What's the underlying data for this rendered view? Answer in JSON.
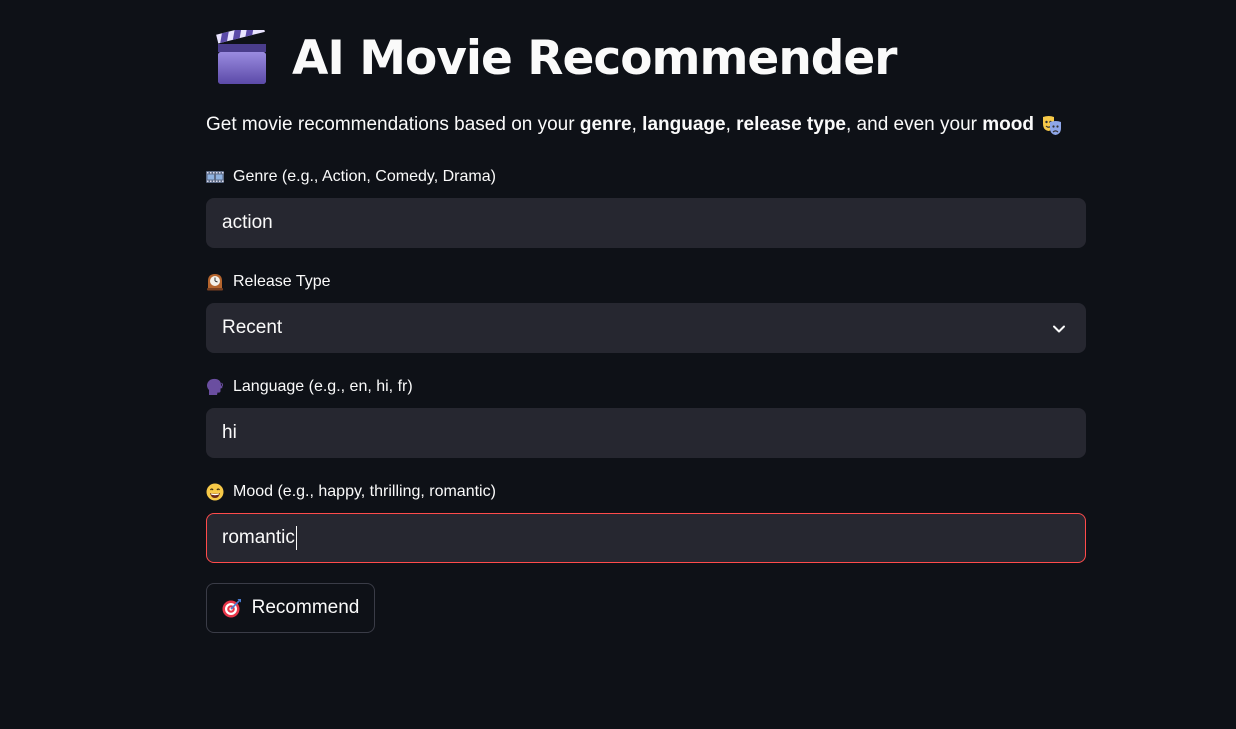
{
  "header": {
    "title": "AI Movie Recommender",
    "title_icon": "clapper-board-icon"
  },
  "intro": {
    "prefix": "Get movie recommendations based on your ",
    "genre_word": "genre",
    "comma1": ", ",
    "language_word": "language",
    "comma2": ", ",
    "release_word": "release type",
    "middle": ", and even your ",
    "mood_word": "mood",
    "trailing_icon": "performing-arts-icon"
  },
  "form": {
    "genre": {
      "label": "Genre (e.g., Action, Comedy, Drama)",
      "icon": "film-frames-icon",
      "value": "action"
    },
    "release_type": {
      "label": "Release Type",
      "icon": "mantelpiece-clock-icon",
      "selected": "Recent"
    },
    "language": {
      "label": "Language (e.g., en, hi, fr)",
      "icon": "speaking-head-icon",
      "value": "hi"
    },
    "mood": {
      "label": "Mood (e.g., happy, thrilling, romantic)",
      "icon": "grinning-face-icon",
      "value": "romantic"
    },
    "submit": {
      "label": "Recommend",
      "icon": "direct-hit-icon"
    }
  },
  "colors": {
    "background": "#0e1117",
    "input_background": "#262730",
    "focus_border": "#ff4b4b",
    "text": "#fafafa"
  }
}
